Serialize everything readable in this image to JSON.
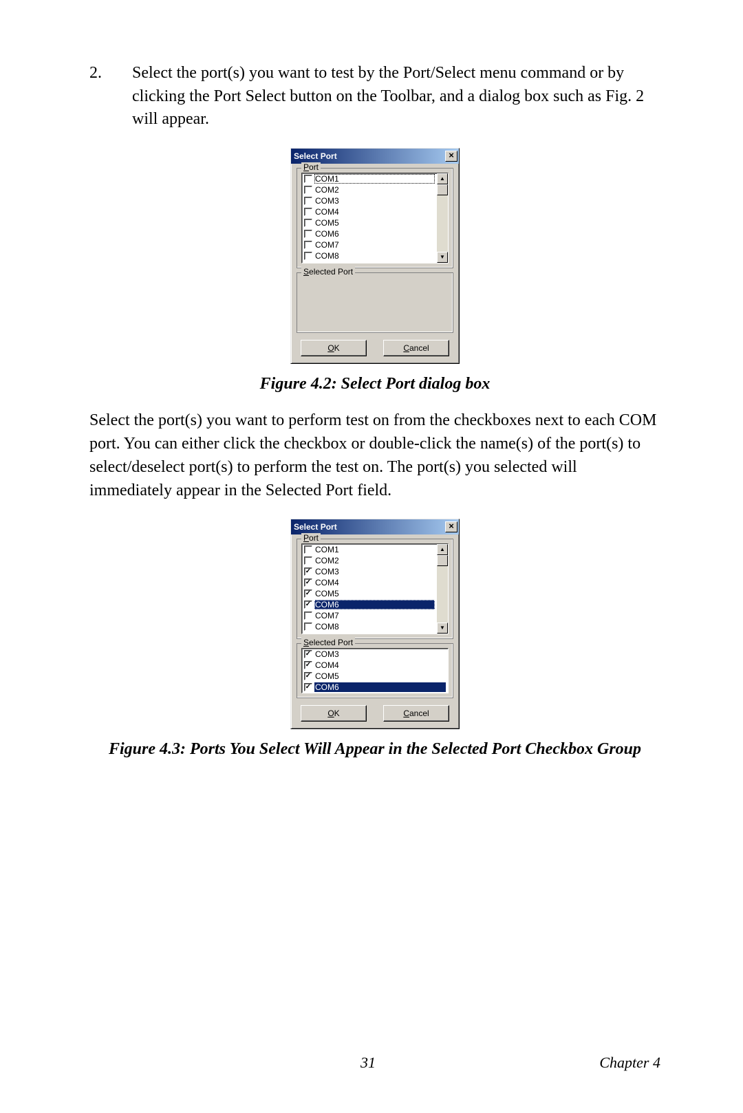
{
  "step": {
    "number": "2.",
    "text": "Select the port(s) you want to test by the Port/Select menu command or by clicking the Port Select button on the Toolbar, and a dialog box such as Fig. 2 will appear."
  },
  "dialog1": {
    "title": "Select Port",
    "close": "×",
    "port_label": "Port",
    "port_label_ul": "P",
    "selected_label": "Selected Port",
    "selected_label_ul": "S",
    "ports": [
      {
        "label": "COM1",
        "checked": false,
        "highlight": false,
        "focus": true
      },
      {
        "label": "COM2",
        "checked": false,
        "highlight": false,
        "focus": false
      },
      {
        "label": "COM3",
        "checked": false,
        "highlight": false,
        "focus": false
      },
      {
        "label": "COM4",
        "checked": false,
        "highlight": false,
        "focus": false
      },
      {
        "label": "COM5",
        "checked": false,
        "highlight": false,
        "focus": false
      },
      {
        "label": "COM6",
        "checked": false,
        "highlight": false,
        "focus": false
      },
      {
        "label": "COM7",
        "checked": false,
        "highlight": false,
        "focus": false
      },
      {
        "label": "COM8",
        "checked": false,
        "highlight": false,
        "focus": false
      }
    ],
    "selected": [],
    "ok": "OK",
    "ok_ul": "O",
    "cancel": "Cancel",
    "cancel_ul": "C"
  },
  "caption1": "Figure 4.2: Select Port dialog box",
  "para": "Select the port(s) you want to perform test on from the checkboxes next to each COM port. You can either click the checkbox or double-click the name(s) of the port(s) to select/deselect port(s) to perform the test on. The port(s) you selected will immediately appear in the Selected Port field.",
  "dialog2": {
    "title": "Select Port",
    "close": "×",
    "port_label": "Port",
    "port_label_ul": "P",
    "selected_label": "Selected Port",
    "selected_label_ul": "S",
    "ports": [
      {
        "label": "COM1",
        "checked": false,
        "highlight": false,
        "focus": false
      },
      {
        "label": "COM2",
        "checked": false,
        "highlight": false,
        "focus": false
      },
      {
        "label": "COM3",
        "checked": true,
        "highlight": false,
        "focus": false
      },
      {
        "label": "COM4",
        "checked": true,
        "highlight": false,
        "focus": false
      },
      {
        "label": "COM5",
        "checked": true,
        "highlight": false,
        "focus": false
      },
      {
        "label": "COM6",
        "checked": true,
        "highlight": true,
        "focus": true
      },
      {
        "label": "COM7",
        "checked": false,
        "highlight": false,
        "focus": false
      },
      {
        "label": "COM8",
        "checked": false,
        "highlight": false,
        "focus": false
      }
    ],
    "selected": [
      {
        "label": "COM3",
        "checked": true,
        "highlight": false,
        "focus": false
      },
      {
        "label": "COM4",
        "checked": true,
        "highlight": false,
        "focus": false
      },
      {
        "label": "COM5",
        "checked": true,
        "highlight": false,
        "focus": false
      },
      {
        "label": "COM6",
        "checked": true,
        "highlight": true,
        "focus": false
      }
    ],
    "ok": "OK",
    "ok_ul": "O",
    "cancel": "Cancel",
    "cancel_ul": "C"
  },
  "caption2": "Figure 4.3: Ports You Select Will Appear in the Selected Port Checkbox Group",
  "footer": {
    "page": "31",
    "chapter": "Chapter 4"
  }
}
